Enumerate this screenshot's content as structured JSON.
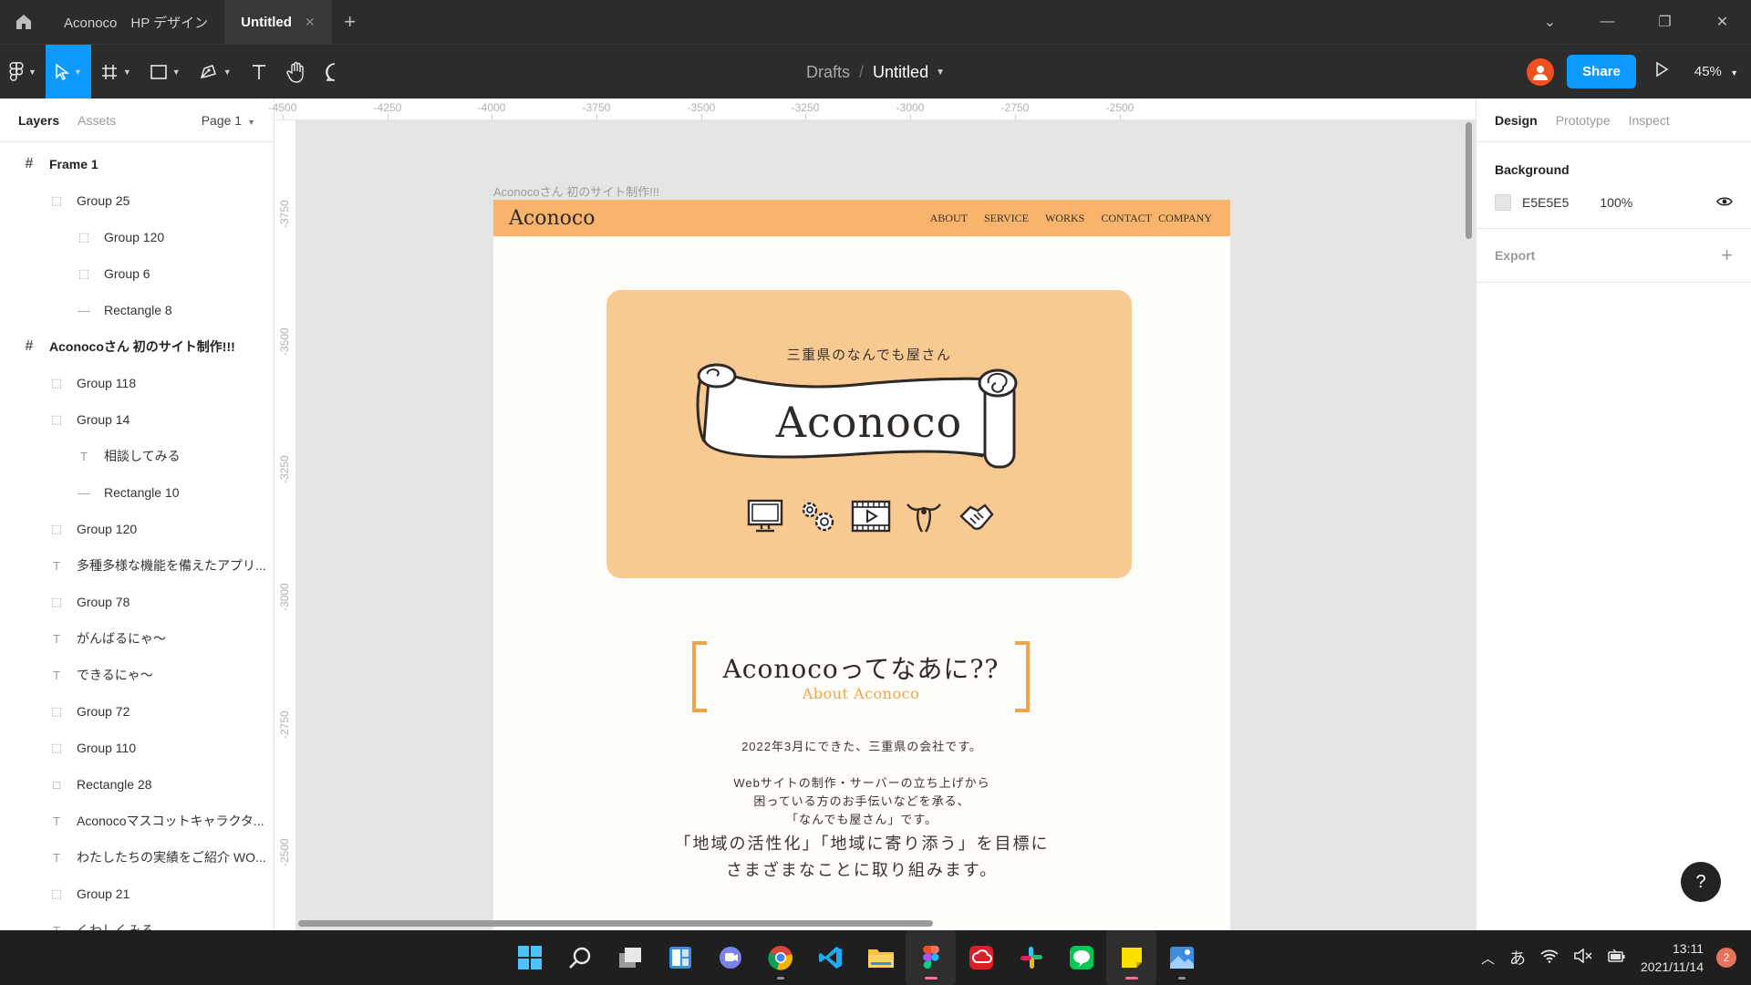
{
  "titlebar": {
    "tabs": [
      {
        "label": "Aconoco　HP デザイン",
        "active": false
      },
      {
        "label": "Untitled",
        "active": true,
        "close": "✕"
      }
    ],
    "new_tab": "+"
  },
  "toolbar": {
    "breadcrumb": {
      "parent": "Drafts",
      "separator": "/",
      "current": "Untitled"
    },
    "share_label": "Share",
    "zoom_label": "45%",
    "active_tool": "move"
  },
  "layers_panel": {
    "tabs": [
      "Layers",
      "Assets"
    ],
    "page_selector": "Page 1",
    "layers": [
      {
        "name": "Frame 1",
        "type": "frame",
        "level": 0
      },
      {
        "name": "Group 25",
        "type": "group",
        "level": 1
      },
      {
        "name": "Group 120",
        "type": "group",
        "level": 2
      },
      {
        "name": "Group 6",
        "type": "group",
        "level": 2
      },
      {
        "name": "Rectangle 8",
        "type": "line",
        "level": 2
      },
      {
        "name": "Aconocoさん 初のサイト制作!!!",
        "type": "frame",
        "level": 0
      },
      {
        "name": "Group 118",
        "type": "group",
        "level": 1
      },
      {
        "name": "Group 14",
        "type": "group",
        "level": 1
      },
      {
        "name": "相談してみる",
        "type": "text",
        "level": 2
      },
      {
        "name": "Rectangle 10",
        "type": "line",
        "level": 2
      },
      {
        "name": "Group 120",
        "type": "group",
        "level": 1
      },
      {
        "name": "多種多様な機能を備えたアプリ...",
        "type": "text",
        "level": 1
      },
      {
        "name": "Group 78",
        "type": "group",
        "level": 1
      },
      {
        "name": "がんばるにゃ～",
        "type": "text",
        "level": 1
      },
      {
        "name": "できるにゃ～",
        "type": "text",
        "level": 1
      },
      {
        "name": "Group 72",
        "type": "group",
        "level": 1
      },
      {
        "name": "Group 110",
        "type": "group",
        "level": 1
      },
      {
        "name": "Rectangle 28",
        "type": "rect",
        "level": 1
      },
      {
        "name": "Aconocoマスコットキャラクタ...",
        "type": "text",
        "level": 1
      },
      {
        "name": "わたしたちの実績をご紹介 WO...",
        "type": "text",
        "level": 1
      },
      {
        "name": "Group 21",
        "type": "group",
        "level": 1
      },
      {
        "name": "くわしくみる",
        "type": "text",
        "level": 1
      }
    ]
  },
  "rulers": {
    "top": [
      "-4500",
      "-4250",
      "-4000",
      "-3750",
      "-3500",
      "-3250",
      "-3000",
      "-2750",
      "-2500"
    ],
    "left": [
      "-3750",
      "-3500",
      "-3250",
      "-3000",
      "-2750",
      "-2500"
    ]
  },
  "canvas": {
    "frame_label": "Aconocoさん 初のサイト制作!!!",
    "site": {
      "logo": "Aconoco",
      "nav": [
        "ABOUT",
        "SERVICE",
        "WORKS",
        "CONTACT",
        "COMPANY"
      ],
      "hero_subtitle": "三重県のなんでも屋さん",
      "hero_title": "Aconoco",
      "hero_icons": [
        "monitor-icon",
        "gears-icon",
        "film-icon",
        "mascot-icon",
        "handshake-icon"
      ],
      "about_title": "Aconocoってなあに??",
      "about_subtitle": "About Aconoco",
      "para1": "2022年3月にできた、三重県の会社です。",
      "para2": [
        "Webサイトの制作・サーバーの立ち上げから",
        "困っている方のお手伝いなどを承る、",
        "「なんでも屋さん」です。"
      ],
      "big": [
        "「地域の活性化」「地域に寄り添う」を目標に",
        "さまざまなことに取り組みます。"
      ]
    }
  },
  "design_panel": {
    "tabs": [
      "Design",
      "Prototype",
      "Inspect"
    ],
    "background_title": "Background",
    "background_color": "E5E5E5",
    "background_opacity": "100%",
    "export_title": "Export",
    "export_add": "+"
  },
  "help_label": "?",
  "taskbar": {
    "apps": [
      "windows-start-icon",
      "search-icon",
      "task-view-icon",
      "widgets-icon",
      "teams-chat-icon",
      "chrome-icon",
      "vscode-icon",
      "file-explorer-icon",
      "figma-icon",
      "creative-cloud-icon",
      "slack-icon",
      "line-icon",
      "sticky-notes-icon",
      "photos-icon"
    ],
    "ime": "あ",
    "time": "13:11",
    "date": "2021/11/14",
    "notification_count": "2"
  },
  "colors": {
    "accent": "#0d99ff",
    "site_nav": "#f7b46a",
    "hero": "#f8ca91",
    "about_accent": "#f0a54d"
  }
}
